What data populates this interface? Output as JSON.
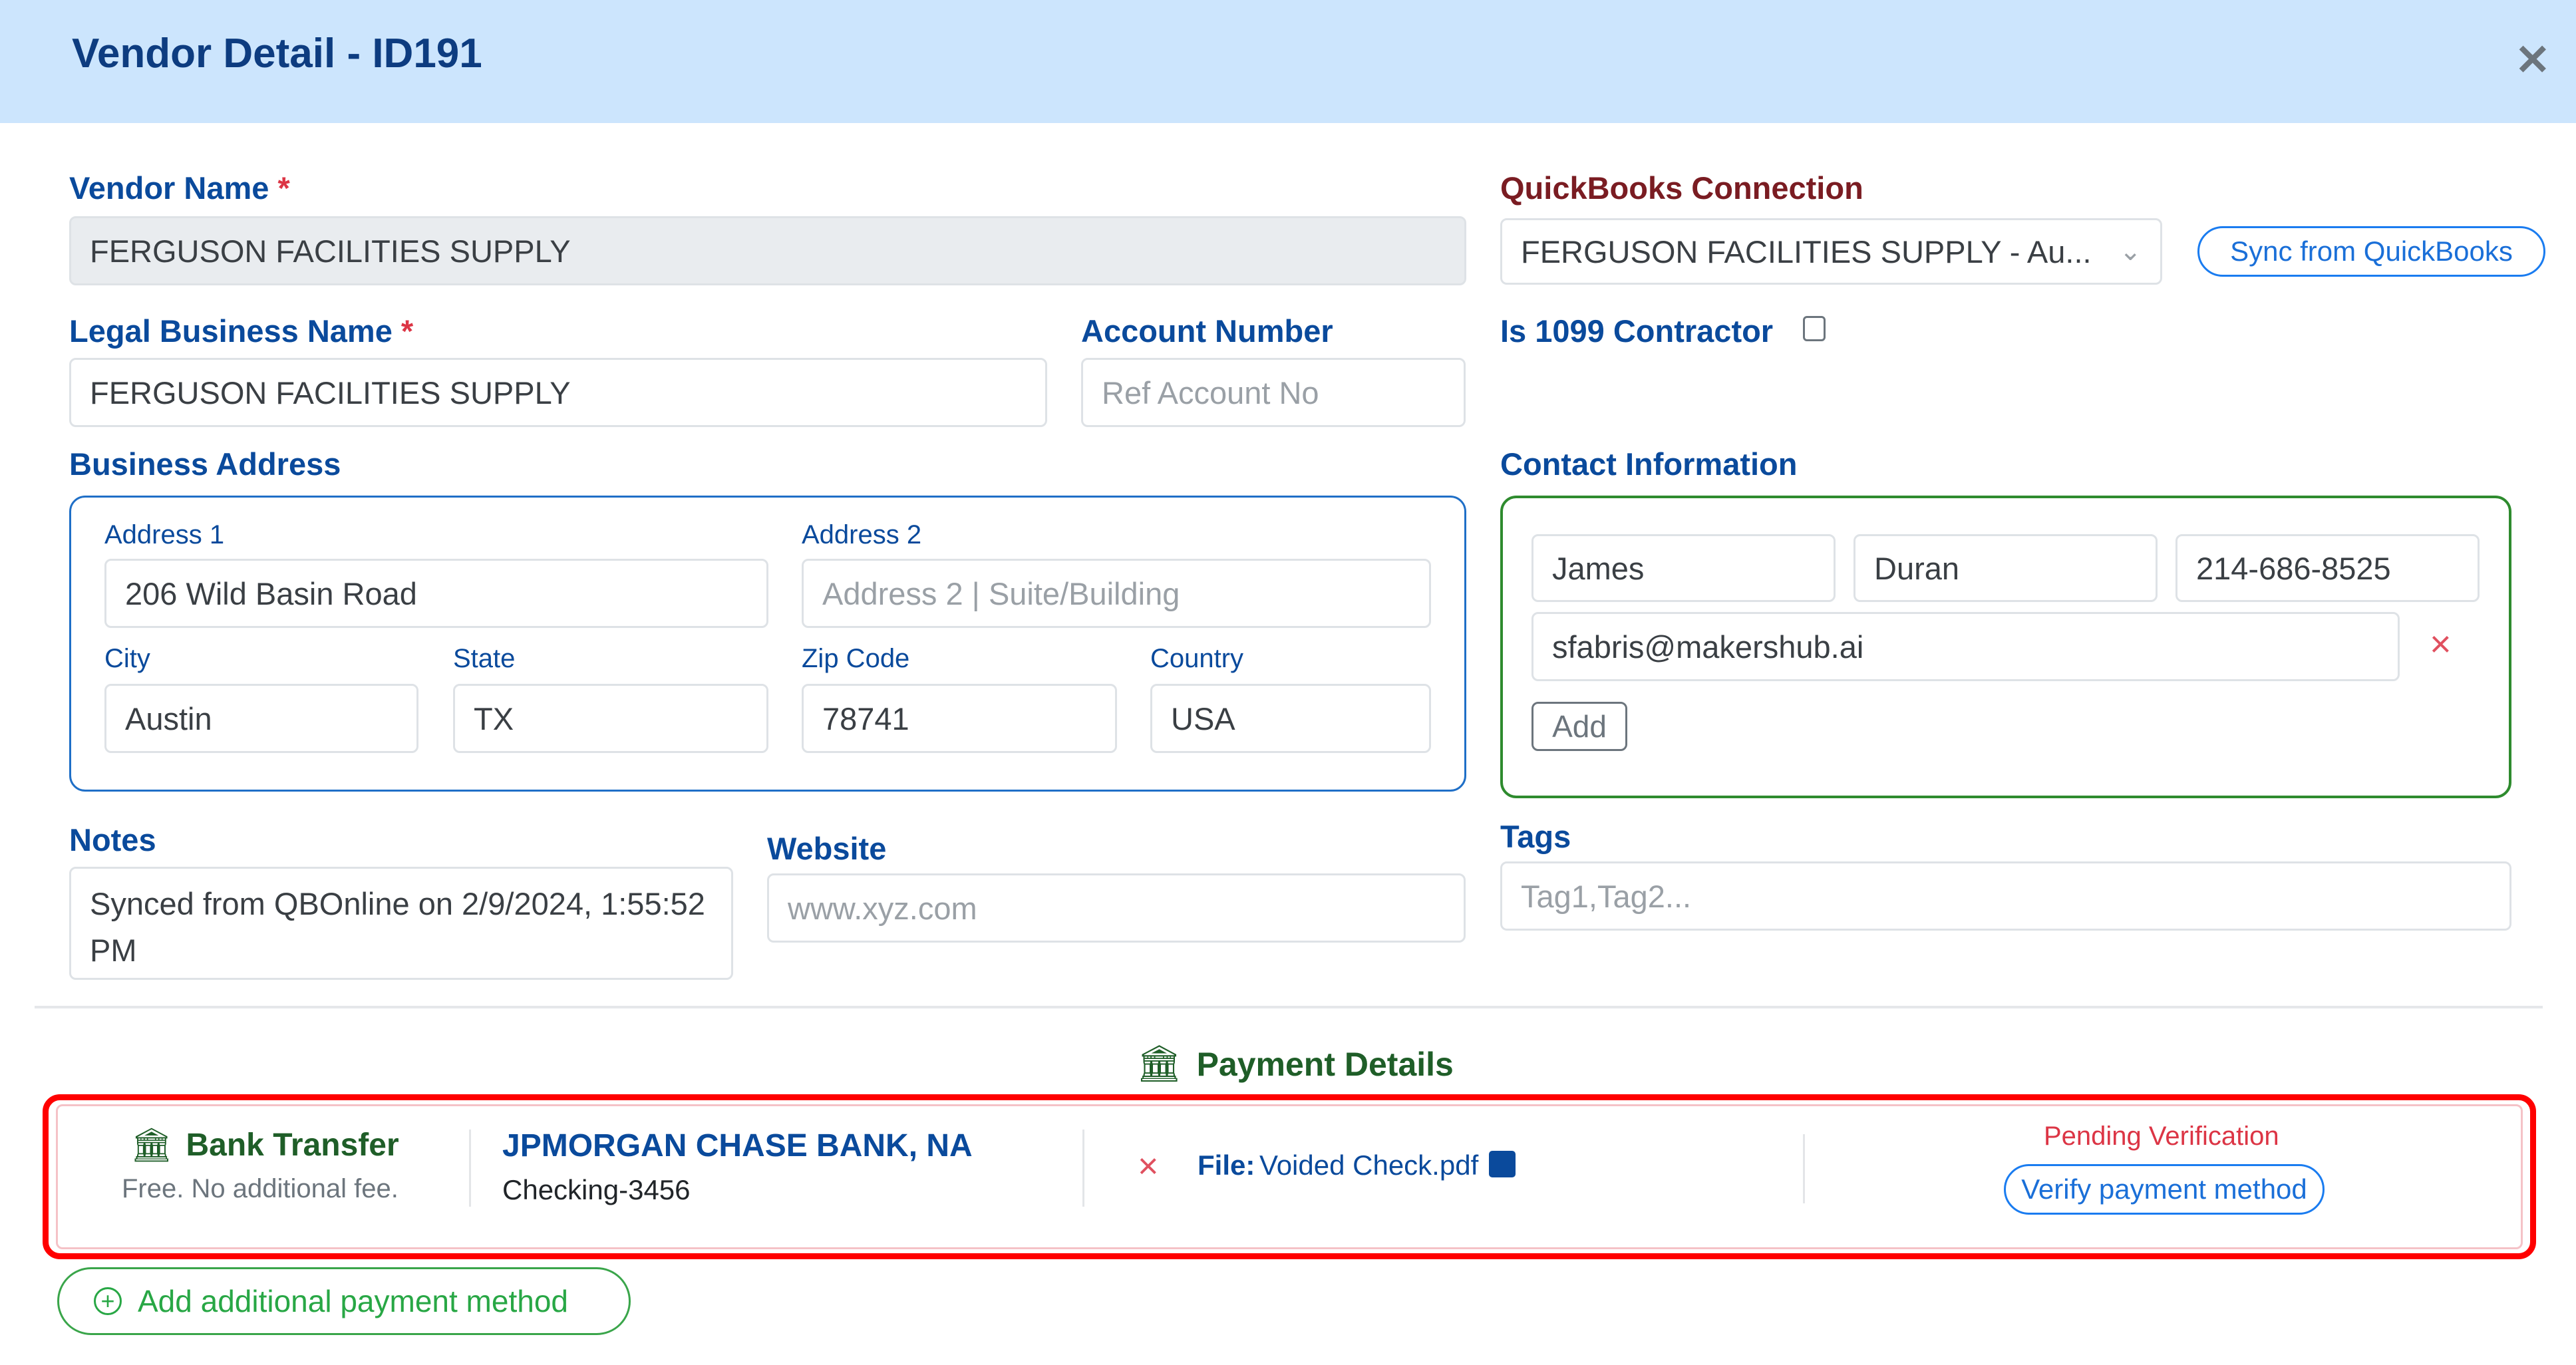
{
  "header": {
    "title": "Vendor Detail - ID191",
    "close_icon": "close-icon"
  },
  "vendor_name": {
    "label": "Vendor Name",
    "required": "*",
    "value": "FERGUSON FACILITIES SUPPLY"
  },
  "legal_name": {
    "label": "Legal Business Name",
    "required": "*",
    "value": "FERGUSON FACILITIES SUPPLY"
  },
  "account_number": {
    "label": "Account Number",
    "placeholder": "Ref Account No"
  },
  "quickbooks": {
    "label": "QuickBooks Connection",
    "selected": "FERGUSON FACILITIES SUPPLY - Au...",
    "sync_label": "Sync from QuickBooks"
  },
  "contractor": {
    "label": "Is 1099 Contractor",
    "checked": false
  },
  "address": {
    "label": "Business Address",
    "address1": {
      "label": "Address 1",
      "value": "206 Wild Basin Road"
    },
    "address2": {
      "label": "Address 2",
      "placeholder": "Address 2 | Suite/Building"
    },
    "city": {
      "label": "City",
      "value": "Austin"
    },
    "state": {
      "label": "State",
      "value": "TX"
    },
    "zip": {
      "label": "Zip Code",
      "value": "78741"
    },
    "country": {
      "label": "Country",
      "value": "USA"
    }
  },
  "contact": {
    "label": "Contact Information",
    "first_name": "James",
    "last_name": "Duran",
    "phone": "214-686-8525",
    "email": "sfabris@makershub.ai",
    "remove_icon": "×",
    "add_label": "Add"
  },
  "notes": {
    "label": "Notes",
    "value": "Synced from QBOnline on 2/9/2024, 1:55:52 PM"
  },
  "website": {
    "label": "Website",
    "placeholder": "www.xyz.com"
  },
  "tags": {
    "label": "Tags",
    "placeholder": "Tag1,Tag2..."
  },
  "payment": {
    "section_title": "Payment Details",
    "method": {
      "name": "Bank Transfer",
      "fee": "Free. No additional fee."
    },
    "bank": {
      "name": "JPMORGAN CHASE BANK, NA",
      "account": "Checking-3456"
    },
    "file": {
      "label": "File:",
      "name": "Voided Check.pdf"
    },
    "status": "Pending Verification",
    "verify_label": "Verify payment method",
    "add_method_label": "Add additional payment method"
  },
  "colors": {
    "header_bg": "#cce5fd",
    "title": "#0d3c80",
    "label_blue": "#0a4a9c",
    "label_qb": "#7a1c22",
    "green": "#1f5e28",
    "highlight_red": "#ff0000",
    "pending_red": "#dc3545"
  }
}
